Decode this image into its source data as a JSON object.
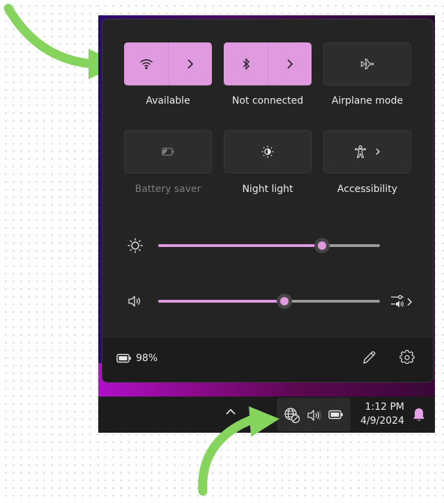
{
  "quick_settings": {
    "tiles": [
      {
        "id": "wifi",
        "label": "Available",
        "state": "on",
        "icon": "wifi-icon",
        "has_expand": true
      },
      {
        "id": "bluetooth",
        "label": "Not connected",
        "state": "on",
        "icon": "bluetooth-icon",
        "has_expand": true
      },
      {
        "id": "airplane",
        "label": "Airplane mode",
        "state": "off",
        "icon": "airplane-icon",
        "has_expand": false
      },
      {
        "id": "battery-saver",
        "label": "Battery saver",
        "state": "disabled",
        "icon": "battery-saver-icon",
        "has_expand": false
      },
      {
        "id": "night-light",
        "label": "Night light",
        "state": "off",
        "icon": "night-light-icon",
        "has_expand": false
      },
      {
        "id": "accessibility",
        "label": "Accessibility",
        "state": "off",
        "icon": "accessibility-icon",
        "has_expand": true
      }
    ],
    "sliders": {
      "brightness": {
        "icon": "brightness-icon",
        "value_fraction": 0.74
      },
      "volume": {
        "icon": "speaker-icon",
        "value_fraction": 0.57,
        "trailing_icon": "audio-output-select-icon"
      }
    },
    "footer": {
      "battery_percent": "98%",
      "edit_icon": "pencil-icon",
      "settings_icon": "gear-icon"
    }
  },
  "taskbar": {
    "overflow_icon": "chevron-up-icon",
    "tray_icons": [
      "globe-no-internet-icon",
      "speaker-icon",
      "battery-icon"
    ],
    "time": "1:12 PM",
    "date": "4/9/2024",
    "notification_icon": "bell-icon"
  },
  "colors": {
    "accent": "#e09ae0",
    "annotation_arrow": "#86d35d",
    "panel_bg": "#242424",
    "taskbar_bg": "#1c1c1c"
  },
  "annotations": [
    {
      "icon": "arrow-icon",
      "points_to": "wifi tile"
    },
    {
      "icon": "arrow-icon",
      "points_to": "system tray network/volume/battery group"
    }
  ]
}
